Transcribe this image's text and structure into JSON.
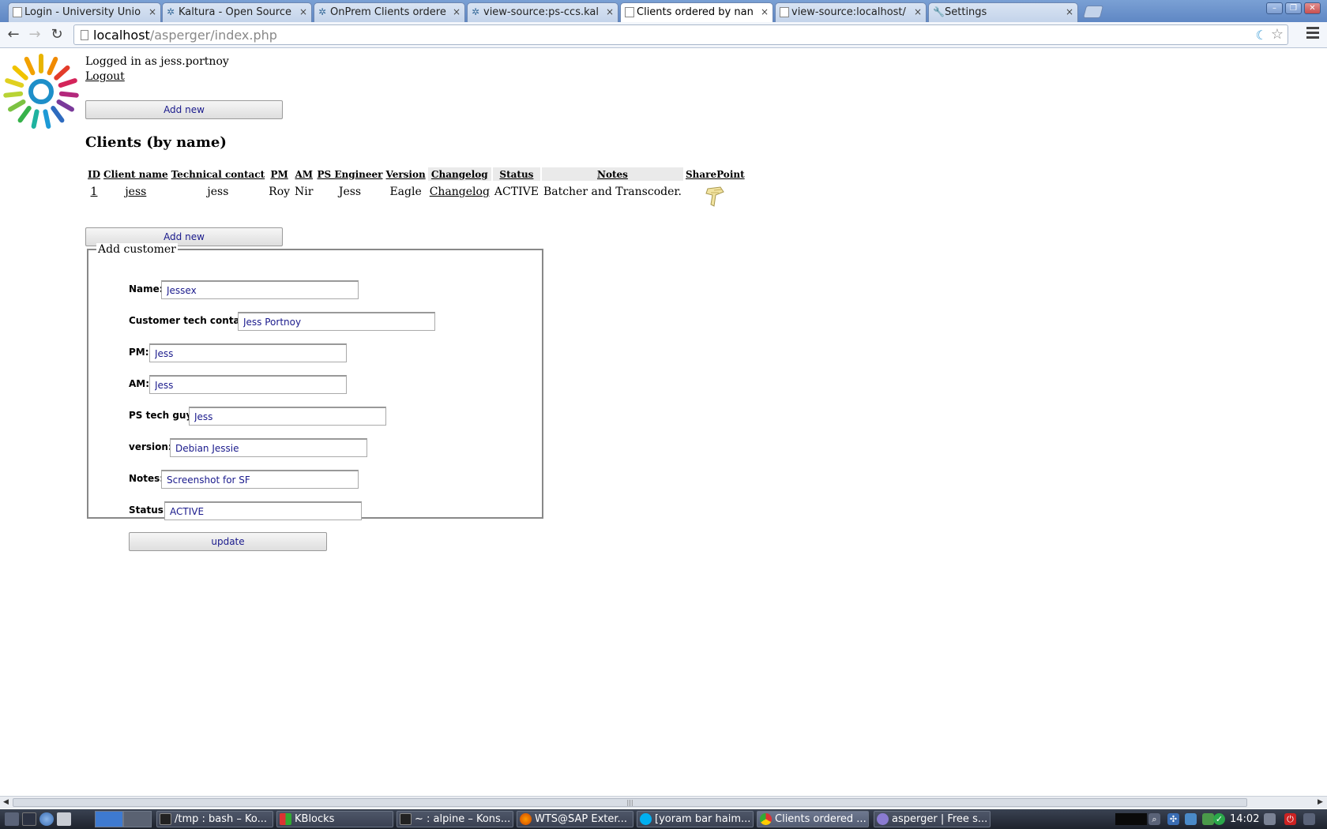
{
  "browser": {
    "tabs": [
      {
        "label": "Login - University Unio",
        "icon": "page-icon",
        "active": false
      },
      {
        "label": "Kaltura - Open Source",
        "icon": "gear-icon",
        "active": false
      },
      {
        "label": "OnPrem Clients ordere",
        "icon": "gear-icon",
        "active": false
      },
      {
        "label": "view-source:ps-ccs.kal",
        "icon": "gear-icon",
        "active": false
      },
      {
        "label": "Clients ordered by nan",
        "icon": "page-icon",
        "active": true
      },
      {
        "label": "view-source:localhost/",
        "icon": "page-icon",
        "active": false
      },
      {
        "label": "Settings",
        "icon": "wrench-icon",
        "active": false
      }
    ],
    "tab_close": "×",
    "url_host": "localhost",
    "url_path": "/asperger/index.php"
  },
  "page": {
    "login_text": "Logged in as jess.portnoy",
    "logout_label": "Logout",
    "add_new_label": "Add new",
    "title": "Clients (by name)",
    "table": {
      "headers": [
        "ID",
        "Client name",
        "Technical contact",
        "PM",
        "AM",
        "PS Engineer",
        "Version",
        "Changelog",
        "Status",
        "Notes",
        "SharePoint"
      ],
      "rows": [
        {
          "id": "1",
          "client_name": "jess",
          "technical_contact": "jess",
          "pm": "Roy",
          "am": "Nir",
          "ps_engineer": "Jess",
          "version": "Eagle",
          "changelog": "Changelog",
          "status": "ACTIVE",
          "notes": "Batcher and Transcoder.",
          "sharepoint_icon": "sharepoint-icon"
        }
      ]
    },
    "form": {
      "legend": "Add customer",
      "fields": [
        {
          "label": "Name:",
          "value": "Jessex"
        },
        {
          "label": "Customer tech contact:",
          "value": "Jess Portnoy"
        },
        {
          "label": "PM:",
          "value": "Jess"
        },
        {
          "label": "AM:",
          "value": "Jess"
        },
        {
          "label": "PS tech guy:",
          "value": "Jess"
        },
        {
          "label": "version:",
          "value": "Debian Jessie"
        },
        {
          "label": "Notes:",
          "value": "Screenshot for SF"
        },
        {
          "label": "Status:",
          "value": "ACTIVE"
        }
      ],
      "update_label": "update"
    }
  },
  "taskbar": {
    "tasks": [
      {
        "label": "/tmp : bash – Ko...",
        "icon": "terminal-icon",
        "active": false
      },
      {
        "label": "KBlocks",
        "icon": "kblocks-icon",
        "active": false
      },
      {
        "label": "~ : alpine – Kons...",
        "icon": "terminal-icon",
        "active": false
      },
      {
        "label": "WTS@SAP Exter...",
        "icon": "firefox-icon",
        "active": false
      },
      {
        "label": "[yoram bar haim...",
        "icon": "skype-icon",
        "active": false
      },
      {
        "label": "Clients ordered ...",
        "icon": "chrome-icon",
        "active": true
      },
      {
        "label": "asperger | Free s...",
        "icon": "pidgin-icon",
        "active": false
      }
    ],
    "clock": "14:02"
  },
  "colors": {
    "link_text": "#1a1a8c",
    "tab_strip": "#6b8fc9",
    "taskbar": "#2a303c"
  }
}
